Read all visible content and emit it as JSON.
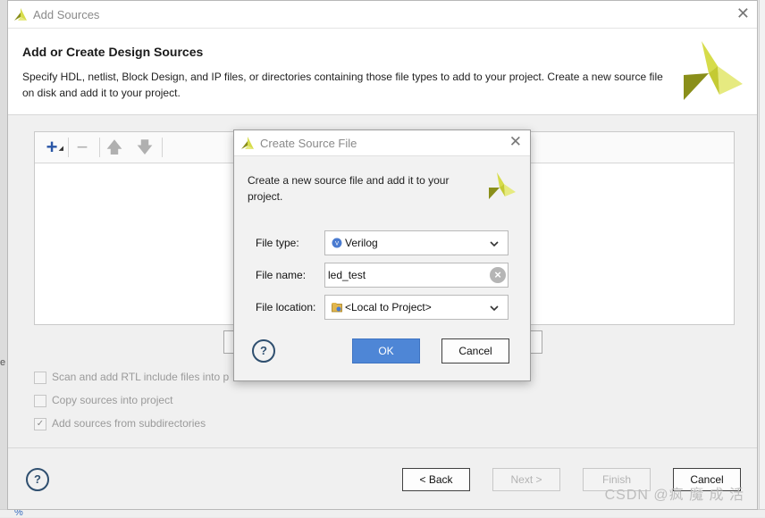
{
  "background": {
    "stray_char": "e",
    "bottom_icon": "%"
  },
  "main_window": {
    "title": "Add Sources",
    "heading": "Add or Create Design Sources",
    "description": "Specify HDL, netlist, Block Design, and IP files, or directories containing those file types to add to your project. Create a new source file on disk and add it to your project.",
    "toolbar": {
      "add_icon": "plus-icon",
      "remove_icon": "minus-icon",
      "up_icon": "arrow-up-icon",
      "down_icon": "arrow-down-icon"
    },
    "options": [
      {
        "label": "Scan and add RTL include files into p",
        "checked": false,
        "enabled": false
      },
      {
        "label": "Copy sources into project",
        "checked": false,
        "enabled": false
      },
      {
        "label": "Add sources from subdirectories",
        "checked": true,
        "enabled": false
      }
    ],
    "buttons": {
      "help": "?",
      "back": "< Back",
      "next": "Next >",
      "finish": "Finish",
      "cancel": "Cancel"
    }
  },
  "dialog": {
    "title": "Create Source File",
    "description": "Create a new source file and add it to your project.",
    "fields": {
      "file_type": {
        "label": "File type:",
        "value": "Verilog"
      },
      "file_name": {
        "label": "File name:",
        "value": "led_test"
      },
      "file_location": {
        "label": "File location:",
        "value": "<Local to Project>"
      }
    },
    "buttons": {
      "help": "?",
      "ok": "OK",
      "cancel": "Cancel"
    }
  },
  "watermark": "CSDN @疯 魔 成 活",
  "colors": {
    "accent_blue": "#4e86d6",
    "logo_yellow": "#d6dc4a",
    "logo_olive": "#8a8f1a"
  }
}
